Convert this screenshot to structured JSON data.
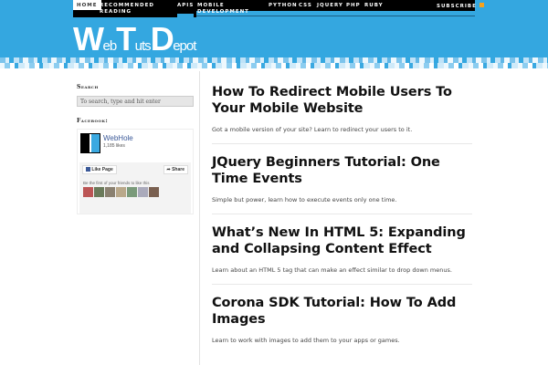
{
  "nav": {
    "items": [
      "HOME",
      "RECOMMENDED READING",
      "APIS",
      "MOBILE DEVELOPMENT",
      "PYTHON",
      "CSS",
      "JQUERY",
      "PHP",
      "RUBY"
    ],
    "subscribe": "SUBSCRIBE"
  },
  "logo": {
    "text": "WebTutsDepot"
  },
  "sidebar": {
    "search_label": "Search",
    "search_placeholder": "To search, type and hit enter",
    "facebook_label": "Facebook:",
    "fb": {
      "name": "WebHole",
      "likes": "1,185 likes",
      "like_btn": "Like Page",
      "share_btn": "Share",
      "friends": "Be the first of your friends to like this"
    }
  },
  "posts": [
    {
      "title": "How To Redirect Mobile Users To Your Mobile Website",
      "excerpt": "Got a mobile version of your site? Learn to redirect your users to it."
    },
    {
      "title": "JQuery Beginners Tutorial: One Time Events",
      "excerpt": "Simple but power, learn how to execute events only one time."
    },
    {
      "title": "What’s New In HTML 5: Expanding and Collapsing Content Effect",
      "excerpt": "Learn about an HTML 5 tag that can make an effect similar to drop down menus."
    },
    {
      "title": "Corona SDK Tutorial: How To Add Images",
      "excerpt": "Learn to work with images to add them to your apps or games."
    }
  ],
  "colors": {
    "brand": "#34a7e0",
    "nav": "#000000"
  }
}
